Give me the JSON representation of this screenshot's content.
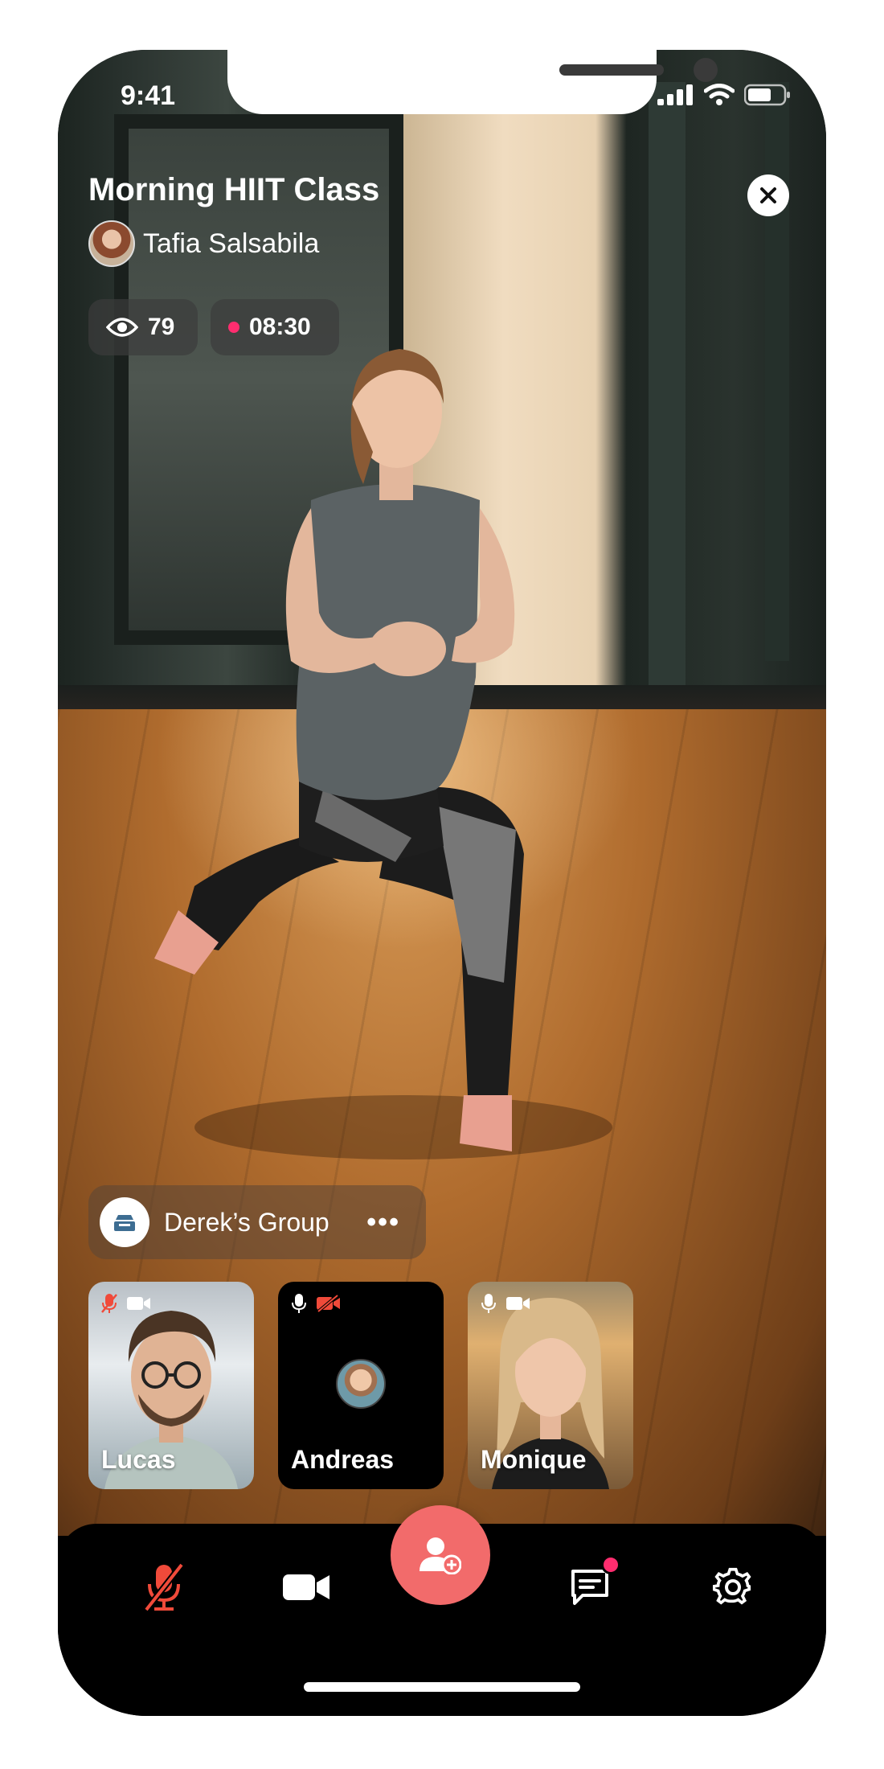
{
  "status_bar": {
    "time": "9:41"
  },
  "header": {
    "title": "Morning HIIT Class",
    "host_name": "Tafia Salsabila",
    "viewers": "79",
    "duration": "08:30"
  },
  "group": {
    "name": "Derek’s Group",
    "more_label": "•••"
  },
  "participants": [
    {
      "name": "Lucas",
      "mic_muted": true,
      "camera_on": true
    },
    {
      "name": "Andreas",
      "mic_muted": false,
      "camera_on": false
    },
    {
      "name": "Monique",
      "mic_muted": false,
      "camera_on": true
    }
  ],
  "colors": {
    "accent": "#f26b6b",
    "alert": "#ff2d6f",
    "muted_icon": "#f04a3a"
  },
  "bottom_bar": {
    "icons": [
      "mic-muted-icon",
      "video-camera-icon",
      "add-participant-icon",
      "chat-icon",
      "settings-icon"
    ]
  }
}
